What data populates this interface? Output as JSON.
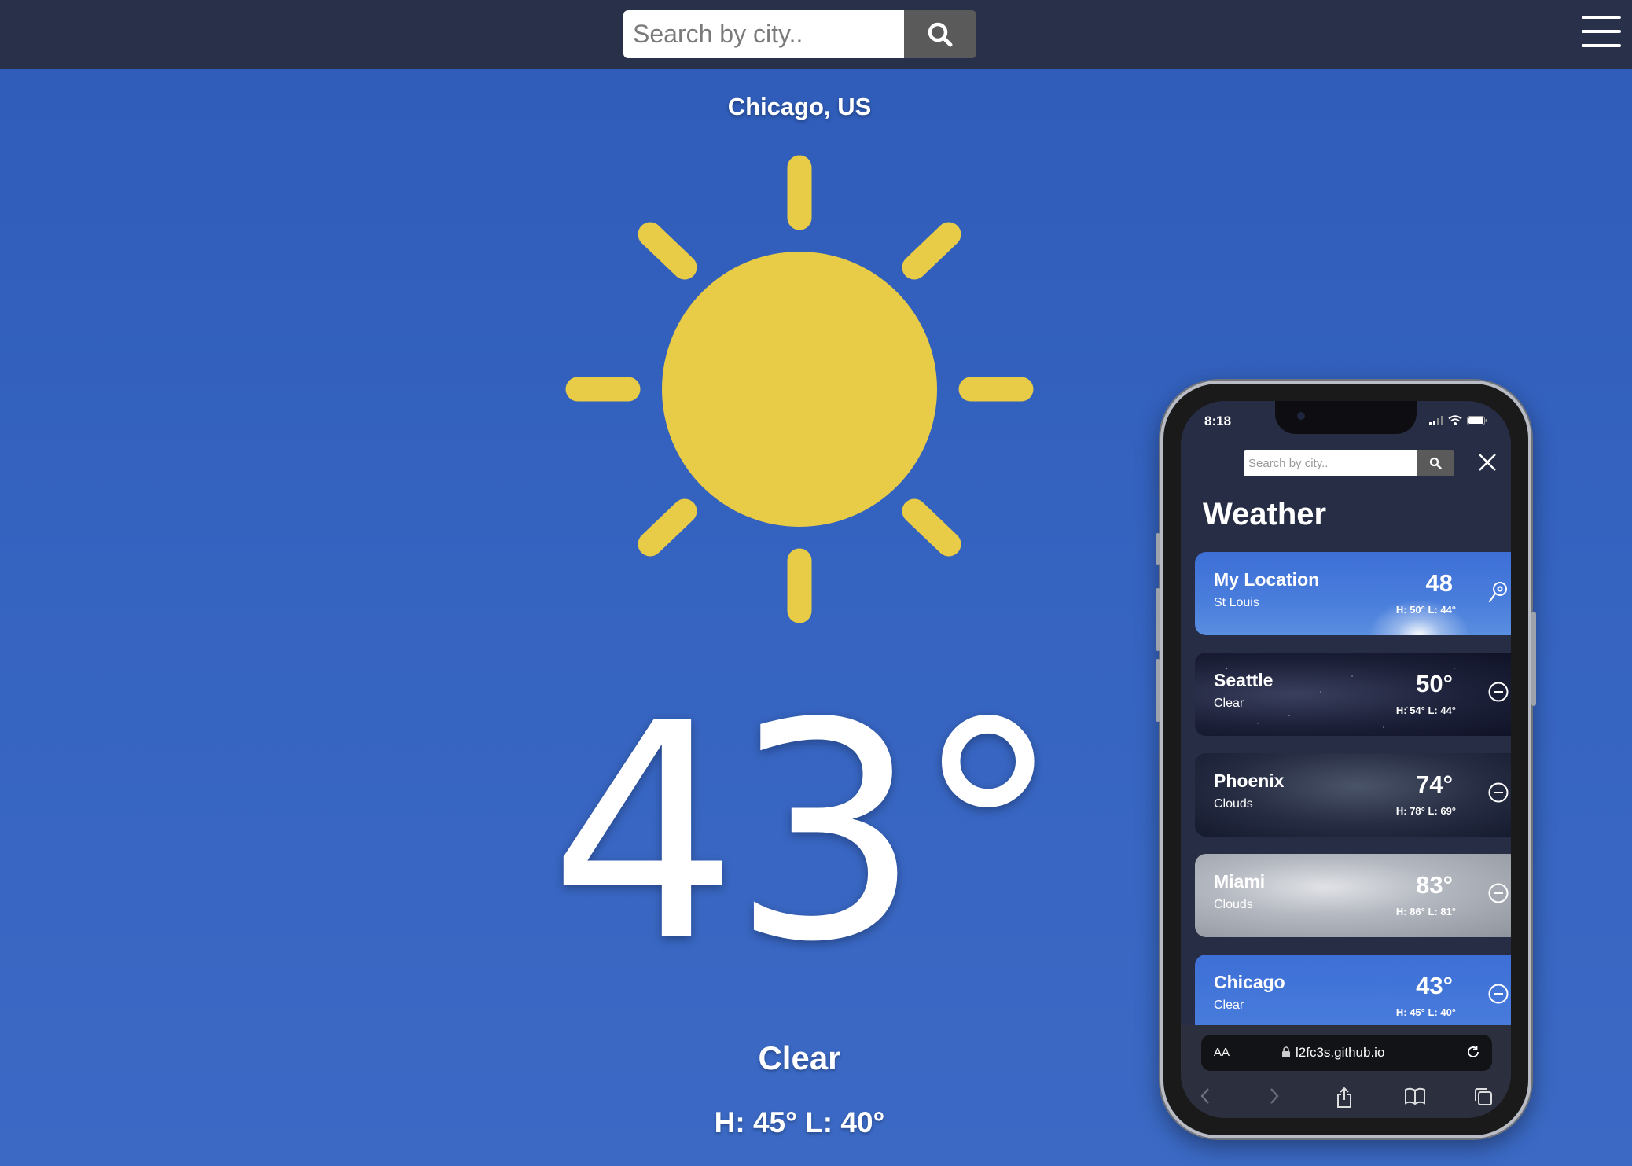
{
  "header": {
    "search_placeholder": "Search by city.."
  },
  "current": {
    "location": "Chicago, US",
    "temperature": "43°",
    "condition": "Clear",
    "high_low": "H: 45° L: 40°"
  },
  "colors": {
    "background": "#3563c0",
    "topbar": "#28304a",
    "sun": "#e8cb46"
  },
  "phone": {
    "status_time": "8:18",
    "search_placeholder": "Search by city..",
    "title": "Weather",
    "cards": [
      {
        "name": "My Location",
        "sub": "St Louis",
        "temp": "48",
        "hilo": "H: 50° L: 44°",
        "icon": "location-pin-icon"
      },
      {
        "name": "Seattle",
        "sub": "Clear",
        "temp": "50°",
        "hilo": "H: 54° L: 44°",
        "icon": "remove-circle-icon"
      },
      {
        "name": "Phoenix",
        "sub": "Clouds",
        "temp": "74°",
        "hilo": "H: 78° L: 69°",
        "icon": "remove-circle-icon"
      },
      {
        "name": "Miami",
        "sub": "Clouds",
        "temp": "83°",
        "hilo": "H: 86° L: 81°",
        "icon": "remove-circle-icon"
      },
      {
        "name": "Chicago",
        "sub": "Clear",
        "temp": "43°",
        "hilo": "H: 45° L: 40°",
        "icon": "remove-circle-icon"
      }
    ],
    "url_aa": "AA",
    "url": "l2fc3s.github.io"
  }
}
